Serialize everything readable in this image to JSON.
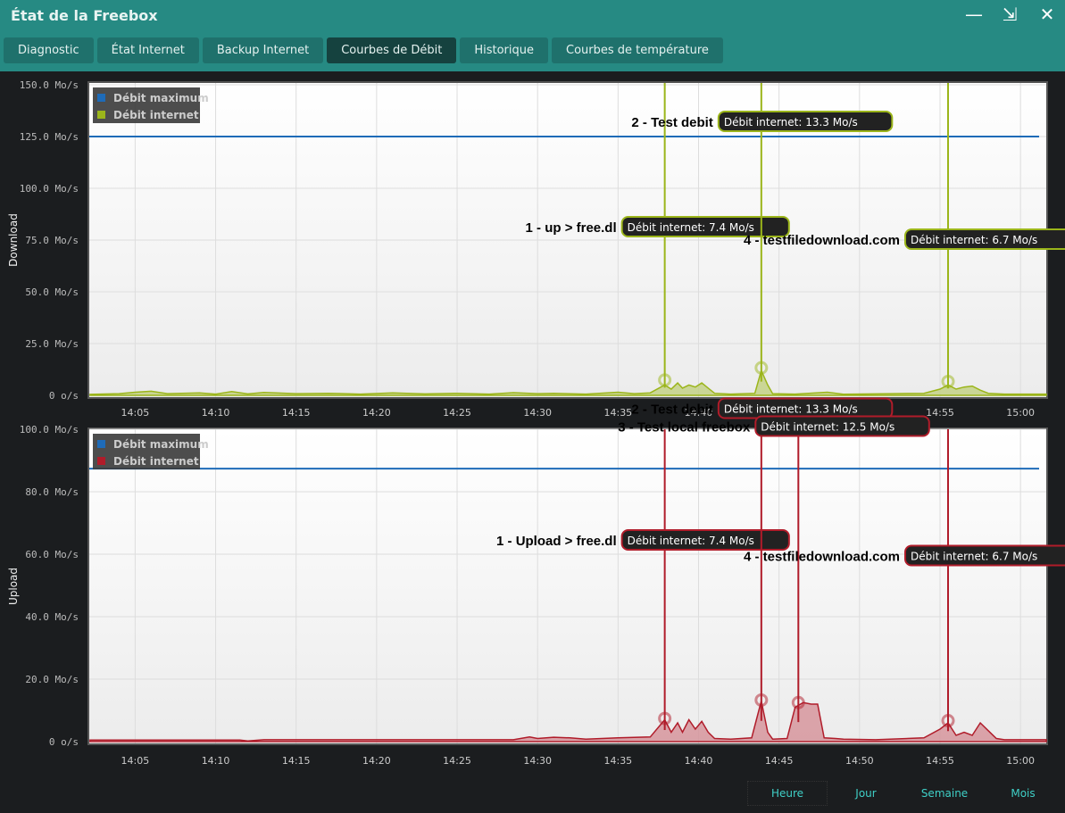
{
  "window": {
    "title": "État de la Freebox",
    "minimize": "—",
    "restore": "⇲",
    "close": "✕"
  },
  "tabs": [
    {
      "label": "Diagnostic"
    },
    {
      "label": "État Internet"
    },
    {
      "label": "Backup Internet"
    },
    {
      "label": "Courbes de Débit",
      "active": true
    },
    {
      "label": "Historique"
    },
    {
      "label": "Courbes de température"
    }
  ],
  "range_buttons": [
    {
      "label": "Heure",
      "selected": true
    },
    {
      "label": "Jour"
    },
    {
      "label": "Semaine"
    },
    {
      "label": "Mois"
    }
  ],
  "chart_data": [
    {
      "type": "area",
      "ylabel": "Download",
      "ylim": [
        0,
        150
      ],
      "yticks": [
        0,
        25,
        50,
        75,
        100,
        125,
        150
      ],
      "ytick_labels": [
        "0 o/s",
        "25.0 Mo/s",
        "50.0 Mo/s",
        "75.0 Mo/s",
        "100.0 Mo/s",
        "125.0 Mo/s",
        "150.0 Mo/s"
      ],
      "xlim": [
        2.15,
        61.6
      ],
      "xticks": [
        5,
        10,
        15,
        20,
        25,
        30,
        35,
        40,
        45,
        50,
        55,
        60
      ],
      "xtick_labels": [
        "14:05",
        "14:10",
        "14:15",
        "14:20",
        "14:25",
        "14:30",
        "14:35",
        "14:40",
        "14:45",
        "14:50",
        "14:55",
        "15:00"
      ],
      "legend": [
        {
          "name": "Débit maximum",
          "color": "#1e6bb8"
        },
        {
          "name": "Débit internet",
          "color": "#9bb51a"
        }
      ],
      "max_line": 125,
      "color": "#9bb51a",
      "fill": "#c2cf7f",
      "series": [
        [
          2.2,
          0.5
        ],
        [
          4,
          0.8
        ],
        [
          5,
          1.5
        ],
        [
          6,
          2
        ],
        [
          7,
          0.8
        ],
        [
          9,
          1.2
        ],
        [
          10,
          0.6
        ],
        [
          11,
          1.8
        ],
        [
          12,
          0.7
        ],
        [
          13,
          1.4
        ],
        [
          15,
          0.8
        ],
        [
          17,
          1
        ],
        [
          19,
          0.6
        ],
        [
          21,
          1.2
        ],
        [
          23,
          0.7
        ],
        [
          25,
          1
        ],
        [
          27,
          0.6
        ],
        [
          28.5,
          1.3
        ],
        [
          30,
          0.8
        ],
        [
          31,
          1
        ],
        [
          33,
          0.6
        ],
        [
          35,
          1.5
        ],
        [
          36,
          0.8
        ],
        [
          37,
          1.2
        ],
        [
          37.9,
          5
        ],
        [
          38.3,
          3
        ],
        [
          38.7,
          6
        ],
        [
          39,
          3.5
        ],
        [
          39.4,
          5
        ],
        [
          39.8,
          4
        ],
        [
          40.2,
          6
        ],
        [
          40.6,
          3.5
        ],
        [
          41,
          1
        ],
        [
          42,
          0.6
        ],
        [
          43.5,
          1
        ],
        [
          43.9,
          12
        ],
        [
          44.3,
          5
        ],
        [
          44.6,
          0.8
        ],
        [
          46,
          0.6
        ],
        [
          48,
          1.5
        ],
        [
          49,
          0.5
        ],
        [
          52,
          0.8
        ],
        [
          54,
          1
        ],
        [
          55,
          3
        ],
        [
          55.5,
          5
        ],
        [
          56,
          3
        ],
        [
          56.5,
          4
        ],
        [
          57,
          4.5
        ],
        [
          57.5,
          2.5
        ],
        [
          58,
          1
        ],
        [
          59,
          0.6
        ],
        [
          61.6,
          0.6
        ]
      ],
      "annotations": [
        {
          "x": 37.9,
          "y": 7.4,
          "name": "1 - up > free.dl",
          "label": "Débit internet: 7.4 Mo/s"
        },
        {
          "x": 43.9,
          "y": 13.3,
          "name": "2 - Test debit",
          "label": "Débit internet: 13.3 Mo/s"
        },
        {
          "x": 55.5,
          "y": 6.7,
          "name": "4 - testfiledownload.com",
          "label": "Débit internet: 6.7 Mo/s"
        }
      ]
    },
    {
      "type": "area",
      "ylabel": "Upload",
      "ylim": [
        0,
        100
      ],
      "yticks": [
        0,
        20,
        40,
        60,
        80,
        100
      ],
      "ytick_labels": [
        "0 o/s",
        "20.0 Mo/s",
        "40.0 Mo/s",
        "60.0 Mo/s",
        "80.0 Mo/s",
        "100.0 Mo/s"
      ],
      "xlim": [
        2.15,
        61.6
      ],
      "xticks": [
        5,
        10,
        15,
        20,
        25,
        30,
        35,
        40,
        45,
        50,
        55,
        60
      ],
      "xtick_labels": [
        "14:05",
        "14:10",
        "14:15",
        "14:20",
        "14:25",
        "14:30",
        "14:35",
        "14:40",
        "14:45",
        "14:50",
        "14:55",
        "15:00"
      ],
      "legend": [
        {
          "name": "Débit maximum",
          "color": "#1e6bb8"
        },
        {
          "name": "Débit internet",
          "color": "#b01c2a"
        }
      ],
      "max_line": 87.4,
      "color": "#b01c2a",
      "fill": "#d49097",
      "series": [
        [
          2.2,
          0.5
        ],
        [
          11.5,
          0.5
        ],
        [
          12,
          0.2
        ],
        [
          13,
          0.6
        ],
        [
          28.5,
          0.6
        ],
        [
          29.5,
          1.5
        ],
        [
          30,
          1
        ],
        [
          31,
          1.4
        ],
        [
          32,
          1.2
        ],
        [
          33,
          0.8
        ],
        [
          35,
          1.2
        ],
        [
          37,
          1.5
        ],
        [
          37.9,
          7
        ],
        [
          38.3,
          3
        ],
        [
          38.7,
          6
        ],
        [
          39,
          3
        ],
        [
          39.4,
          7
        ],
        [
          39.8,
          4
        ],
        [
          40.2,
          6.5
        ],
        [
          40.6,
          3
        ],
        [
          41,
          1
        ],
        [
          42,
          0.8
        ],
        [
          43.3,
          1.2
        ],
        [
          43.9,
          13
        ],
        [
          44.3,
          3
        ],
        [
          44.6,
          0.8
        ],
        [
          45.5,
          1
        ],
        [
          46,
          11
        ],
        [
          46.5,
          12.5
        ],
        [
          47,
          12
        ],
        [
          47.4,
          12
        ],
        [
          47.8,
          1.2
        ],
        [
          48.5,
          1
        ],
        [
          49,
          0.8
        ],
        [
          51,
          0.6
        ],
        [
          54,
          1.2
        ],
        [
          55,
          4
        ],
        [
          55.5,
          6
        ],
        [
          56,
          2
        ],
        [
          56.5,
          3
        ],
        [
          57,
          2
        ],
        [
          57.5,
          6
        ],
        [
          58,
          3.5
        ],
        [
          58.5,
          1
        ],
        [
          59,
          0.6
        ],
        [
          61.6,
          0.6
        ]
      ],
      "annotations": [
        {
          "x": 37.9,
          "y": 7.4,
          "name": "1 - Upload > free.dl",
          "label": "Débit internet: 7.4 Mo/s"
        },
        {
          "x": 43.9,
          "y": 13.3,
          "name": "2 - Test debit",
          "label": "Débit internet: 13.3 Mo/s"
        },
        {
          "x": 46.2,
          "y": 12.5,
          "name": "3 - Test local freebox",
          "label": "Débit internet: 12.5 Mo/s"
        },
        {
          "x": 55.5,
          "y": 6.7,
          "name": "4 - testfiledownload.com",
          "label": "Débit internet: 6.7 Mo/s"
        }
      ]
    }
  ]
}
